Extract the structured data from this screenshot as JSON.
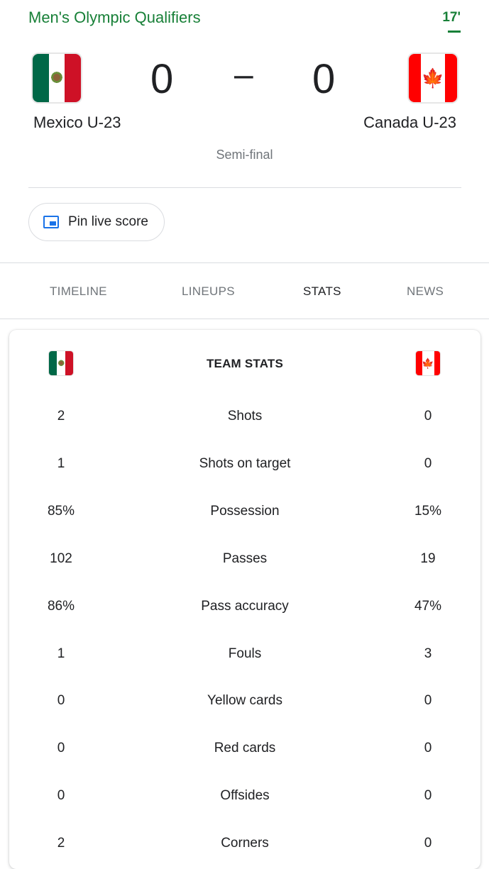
{
  "header": {
    "competition": "Men's Olympic Qualifiers",
    "minute": "17'",
    "stage": "Semi-final",
    "home": {
      "name": "Mexico U-23",
      "score": "0",
      "flag": "mexico-flag"
    },
    "away": {
      "name": "Canada U-23",
      "score": "0",
      "flag": "canada-flag"
    },
    "score_separator": "–",
    "pin_label": "Pin live score"
  },
  "tabs": [
    {
      "label": "TIMELINE",
      "active": false
    },
    {
      "label": "LINEUPS",
      "active": false
    },
    {
      "label": "STATS",
      "active": true
    },
    {
      "label": "NEWS",
      "active": false
    }
  ],
  "stats_card": {
    "title": "TEAM STATS",
    "rows": [
      {
        "label": "Shots",
        "home": "2",
        "away": "0"
      },
      {
        "label": "Shots on target",
        "home": "1",
        "away": "0"
      },
      {
        "label": "Possession",
        "home": "85%",
        "away": "15%"
      },
      {
        "label": "Passes",
        "home": "102",
        "away": "19"
      },
      {
        "label": "Pass accuracy",
        "home": "86%",
        "away": "47%"
      },
      {
        "label": "Fouls",
        "home": "1",
        "away": "3"
      },
      {
        "label": "Yellow cards",
        "home": "0",
        "away": "0"
      },
      {
        "label": "Red cards",
        "home": "0",
        "away": "0"
      },
      {
        "label": "Offsides",
        "home": "0",
        "away": "0"
      },
      {
        "label": "Corners",
        "home": "2",
        "away": "0"
      }
    ]
  },
  "colors": {
    "accent_green": "#188038",
    "pin_icon_blue": "#1a73e8",
    "text_primary": "#202124",
    "text_secondary": "#70757a"
  }
}
